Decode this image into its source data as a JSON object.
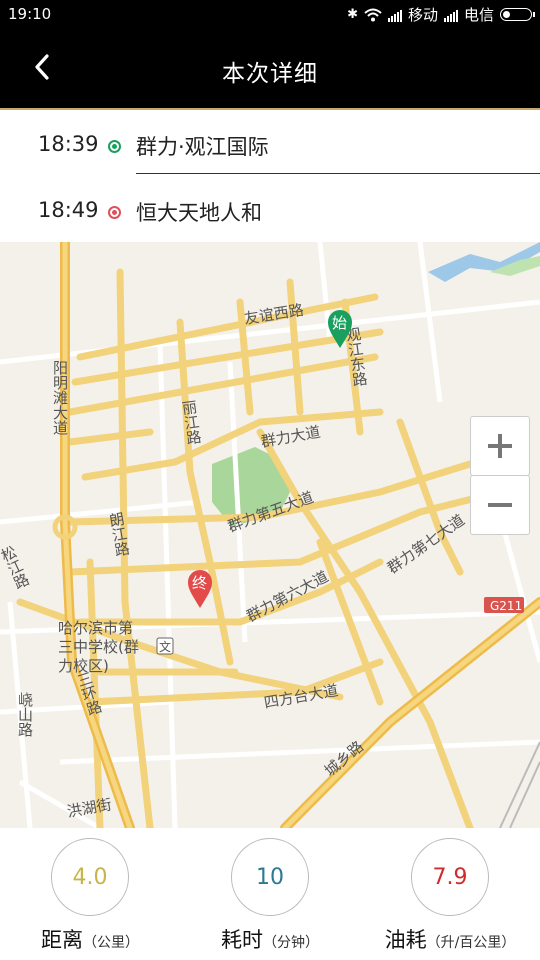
{
  "status": {
    "time": "19:10",
    "carrier1": "移动",
    "carrier2": "电信"
  },
  "header": {
    "title": "本次详细"
  },
  "trip": {
    "start": {
      "time": "18:39",
      "place": "群力·观江国际",
      "color": "#1aa05e"
    },
    "end": {
      "time": "18:49",
      "place": "恒大天地人和",
      "color": "#e0505a"
    }
  },
  "map": {
    "markers": {
      "start": "始",
      "end": "终"
    },
    "labels": {
      "youyi": "友谊西路",
      "guanjiang": "观江东路",
      "yangming": "阳明滩大道",
      "lijiang": "丽江路",
      "qunli": "群力大道",
      "qunli5": "群力第五大道",
      "qunli6": "群力第六大道",
      "qunli7": "群力第七大道",
      "langjiang": "朗江路",
      "songjiang": "松江路",
      "school1": "哈尔滨市第",
      "school2": "三中学校(群",
      "school3": "力校区)",
      "school_icon": "文",
      "g211": "G211",
      "sifangtai": "四方台大道",
      "sanhuan": "三环路",
      "xiaoshan": "峣山路",
      "chengxiang": "城乡路",
      "honghu": "洪湖街"
    }
  },
  "stats": [
    {
      "value": "4.0",
      "label": "距离",
      "unit": "（公里）",
      "color": "#c8b44a"
    },
    {
      "value": "10",
      "label": "耗时",
      "unit": "（分钟）",
      "color": "#2a7a94"
    },
    {
      "value": "7.9",
      "label": "油耗",
      "unit": "（升/百公里）",
      "color": "#d02a2a"
    }
  ]
}
